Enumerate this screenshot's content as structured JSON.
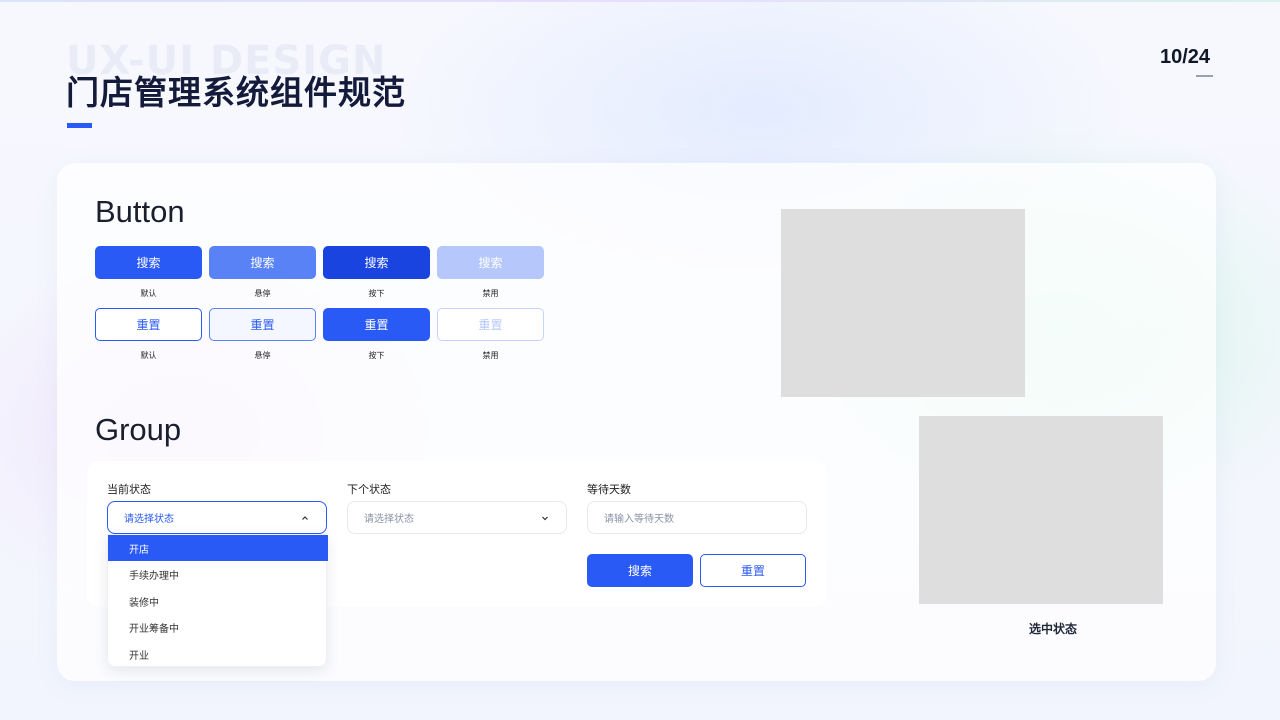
{
  "header": {
    "watermark": "UX-UI DESIGN",
    "title": "门店管理系统组件规范",
    "page_number": "10/24"
  },
  "colors": {
    "primary": "#2a5af5",
    "primary_hover": "#5a82f7",
    "primary_pressed": "#1a44e0",
    "primary_disabled": "#b5c7fb",
    "image_placeholder": "#dedede"
  },
  "button_section": {
    "title": "Button",
    "primary_row": [
      {
        "label": "搜索",
        "state": "默认"
      },
      {
        "label": "搜索",
        "state": "悬停"
      },
      {
        "label": "搜索",
        "state": "按下"
      },
      {
        "label": "搜索",
        "state": "禁用"
      }
    ],
    "outline_row": [
      {
        "label": "重置",
        "state": "默认"
      },
      {
        "label": "重置",
        "state": "悬停"
      },
      {
        "label": "重置",
        "state": "按下"
      },
      {
        "label": "重置",
        "state": "禁用"
      }
    ]
  },
  "group_section": {
    "title": "Group",
    "fields": [
      {
        "label": "当前状态",
        "placeholder": "请选择状态",
        "icon": "chevron-up-icon"
      },
      {
        "label": "下个状态",
        "placeholder": "请选择状态",
        "icon": "chevron-down-icon"
      },
      {
        "label": "等待天数",
        "placeholder": "请输入等待天数"
      }
    ],
    "search_label": "搜索",
    "reset_label": "重置",
    "dropdown_options": [
      "开店",
      "手续办理中",
      "装修中",
      "开业筹备中",
      "开业"
    ],
    "selected_option": "开店"
  },
  "images": {
    "selected_caption": "选中状态"
  }
}
